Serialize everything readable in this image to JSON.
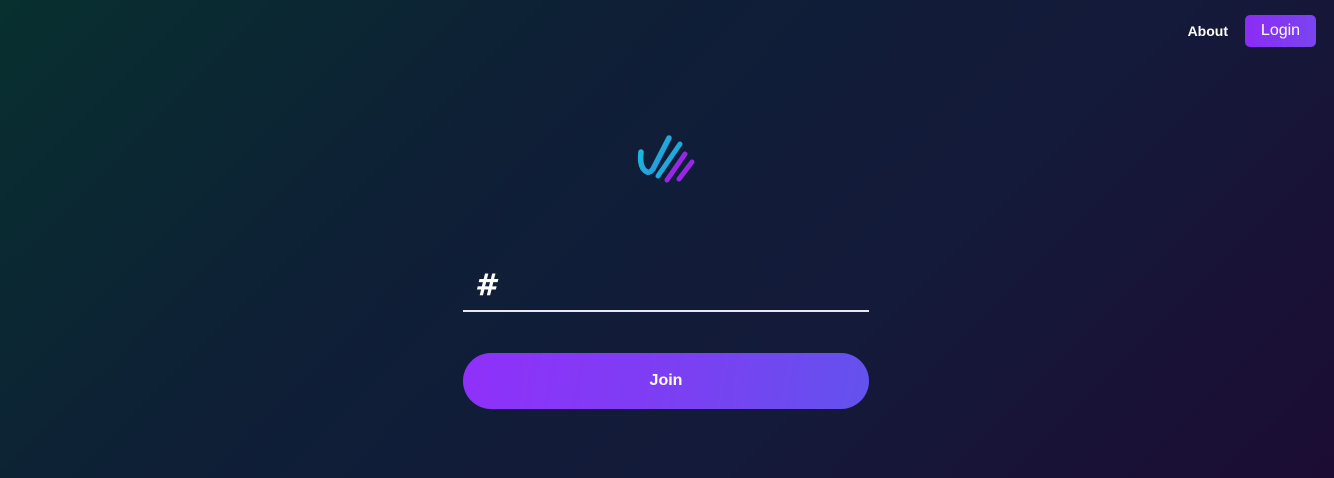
{
  "nav": {
    "about_label": "About",
    "login_label": "Login"
  },
  "logo": {
    "icon": "checkmark-stripes-logo",
    "colors": {
      "cyan": "#1fb3d9",
      "purple": "#9b1fe6"
    }
  },
  "room": {
    "prefix": "#",
    "value": "",
    "placeholder": ""
  },
  "join": {
    "label": "Join"
  },
  "colors": {
    "accent": "#8b2cf5",
    "accent_end": "#6352ee",
    "underline": "#e8e8ee"
  }
}
